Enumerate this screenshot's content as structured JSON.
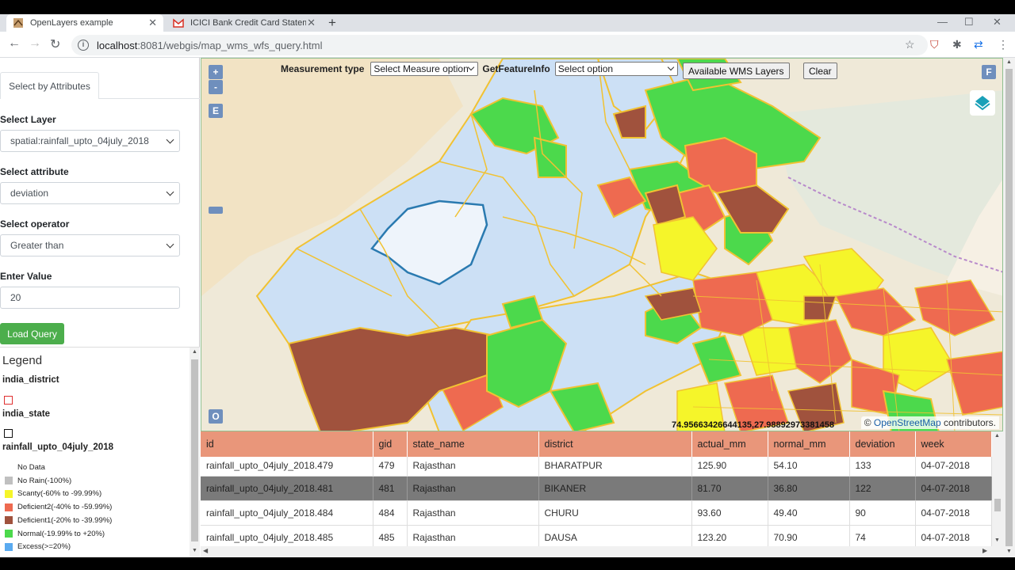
{
  "browser": {
    "tabs": [
      {
        "title": "OpenLayers example",
        "active": true
      },
      {
        "title": "ICICI Bank Credit Card Statement",
        "active": false
      }
    ],
    "url_host": "localhost",
    "url_path": ":8081/webgis/map_wms_wfs_query.html"
  },
  "panel": {
    "tab_label": "Select by Attributes",
    "layer_label": "Select Layer",
    "layer_value": "spatial:rainfall_upto_04july_2018",
    "attribute_label": "Select attribute",
    "attribute_value": "deviation",
    "operator_label": "Select operator",
    "operator_value": "Greater than",
    "value_label": "Enter Value",
    "value_input": "20",
    "load_button": "Load Query"
  },
  "legend": {
    "title": "Legend",
    "layers": [
      "india_district",
      "india_state",
      "rainfall_upto_04july_2018"
    ],
    "items": [
      {
        "label": "No Data",
        "color": "#ffffff"
      },
      {
        "label": "No Rain(-100%)",
        "color": "#c0c0c0"
      },
      {
        "label": "Scanty(-60% to -99.99%)",
        "color": "#f5f52a"
      },
      {
        "label": "Deficient2(-40% to -59.99%)",
        "color": "#ee6a50"
      },
      {
        "label": "Deficient1(-20% to -39.99%)",
        "color": "#a0523d"
      },
      {
        "label": "Normal(-19.99% to +20%)",
        "color": "#4cd94c"
      },
      {
        "label": "Excess(>=20%)",
        "color": "#5aaaf0"
      }
    ]
  },
  "map": {
    "zoom_in": "+",
    "zoom_out": "-",
    "extent_btn": "E",
    "fullscreen_btn": "F",
    "overview_btn": "O",
    "measurement_label": "Measurement type",
    "measurement_value": "Select Measure option",
    "getfeature_label": "GetFeatureInfo",
    "getfeature_value": "Select option",
    "wms_button": "Available WMS Layers",
    "clear_button": "Clear",
    "coordinates": "74.95663426644135,27.98892973381458",
    "attribution_prefix": "©",
    "attribution_link": "OpenStreetMap",
    "attribution_suffix": "contributors."
  },
  "table": {
    "columns": [
      "id",
      "gid",
      "state_name",
      "district",
      "actual_mm",
      "normal_mm",
      "deviation",
      "week"
    ],
    "rows": [
      [
        "rainfall_upto_04july_2018.479",
        "479",
        "Rajasthan",
        "BHARATPUR",
        "125.90",
        "54.10",
        "133",
        "04-07-2018"
      ],
      [
        "rainfall_upto_04july_2018.481",
        "481",
        "Rajasthan",
        "BIKANER",
        "81.70",
        "36.80",
        "122",
        "04-07-2018"
      ],
      [
        "rainfall_upto_04july_2018.484",
        "484",
        "Rajasthan",
        "CHURU",
        "93.60",
        "49.40",
        "90",
        "04-07-2018"
      ],
      [
        "rainfall_upto_04july_2018.485",
        "485",
        "Rajasthan",
        "DAUSA",
        "123.20",
        "70.90",
        "74",
        "04-07-2018"
      ]
    ],
    "selected_row": 1
  }
}
